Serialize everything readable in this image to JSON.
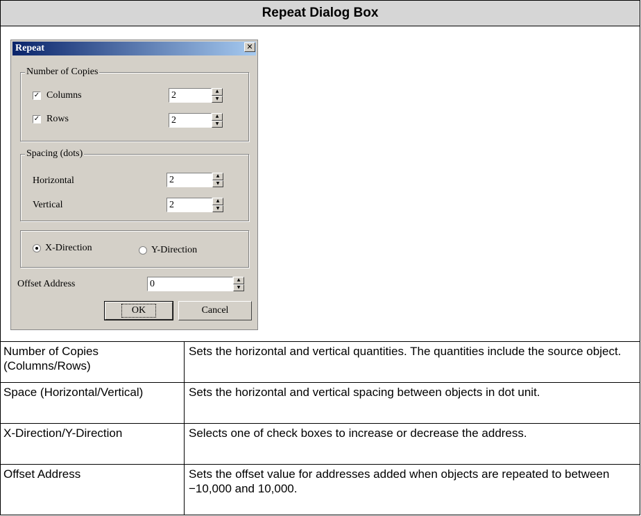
{
  "header": {
    "title": "Repeat Dialog Box"
  },
  "dialog": {
    "title": "Repeat",
    "close_glyph": "✕",
    "copies_group": "Number of Copies",
    "columns_label": "Columns",
    "columns_checked": true,
    "columns_value": "2",
    "rows_label": "Rows",
    "rows_checked": true,
    "rows_value": "2",
    "spacing_group": "Spacing (dots)",
    "horizontal_label": "Horizontal",
    "horizontal_value": "2",
    "vertical_label": "Vertical",
    "vertical_value": "2",
    "x_direction_label": "X-Direction",
    "y_direction_label": "Y-Direction",
    "selected_direction": "X-Direction",
    "offset_label": "Offset Address",
    "offset_value": "0",
    "ok_label": "OK",
    "cancel_label": "Cancel",
    "check_glyph": "✓",
    "spin_up_glyph": "▲",
    "spin_down_glyph": "▼"
  },
  "table": {
    "rows": [
      {
        "term": "Number of Copies (Columns/Rows)",
        "description": "Sets the horizontal and vertical quantities. The quantities include the source object."
      },
      {
        "term": "Space (Horizontal/Vertical)",
        "description": "Sets the horizontal and vertical spacing between objects in dot unit."
      },
      {
        "term": "X-Direction/Y-Direction",
        "description": "Selects one of check boxes to increase or decrease the address."
      },
      {
        "term": "Offset Address",
        "description": "Sets the offset value for addresses added when objects are repeated to between −10,000 and 10,000."
      }
    ]
  }
}
